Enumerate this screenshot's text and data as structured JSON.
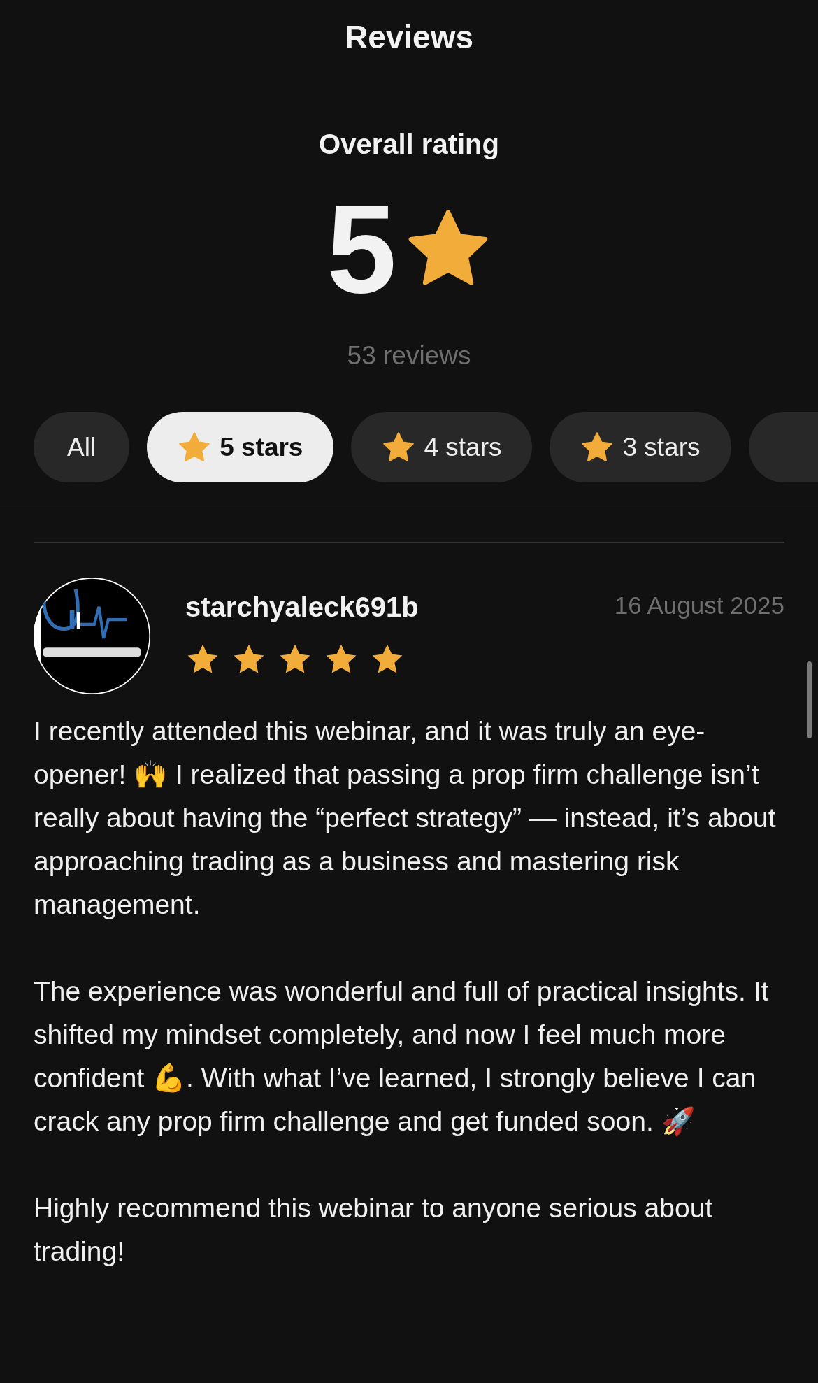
{
  "header": {
    "title": "Reviews"
  },
  "overall": {
    "label": "Overall rating",
    "score": "5",
    "count": "53 reviews"
  },
  "filters": [
    {
      "kind": "all",
      "label": "All",
      "selected": false
    },
    {
      "kind": "stars",
      "label": "5 stars",
      "selected": true
    },
    {
      "kind": "stars",
      "label": "4 stars",
      "selected": false
    },
    {
      "kind": "stars",
      "label": "3 stars",
      "selected": false
    }
  ],
  "reviews": [
    {
      "author": "starchyaleck691b",
      "date": "16 August 2025",
      "stars": 5,
      "paragraphs": [
        "I recently attended this webinar, and it was truly an eye-opener! 🙌 I realized that passing a prop firm challenge isn’t really about having the “perfect strategy” — instead, it’s about approaching trading as a business and mastering risk management.",
        "The experience was wonderful and full of practical insights. It shifted my mindset completely, and now I feel much more confident 💪. With what I’ve learned, I strongly believe I can crack any prop firm challenge and get funded soon. 🚀",
        "Highly recommend this webinar to anyone serious about trading!"
      ]
    }
  ]
}
